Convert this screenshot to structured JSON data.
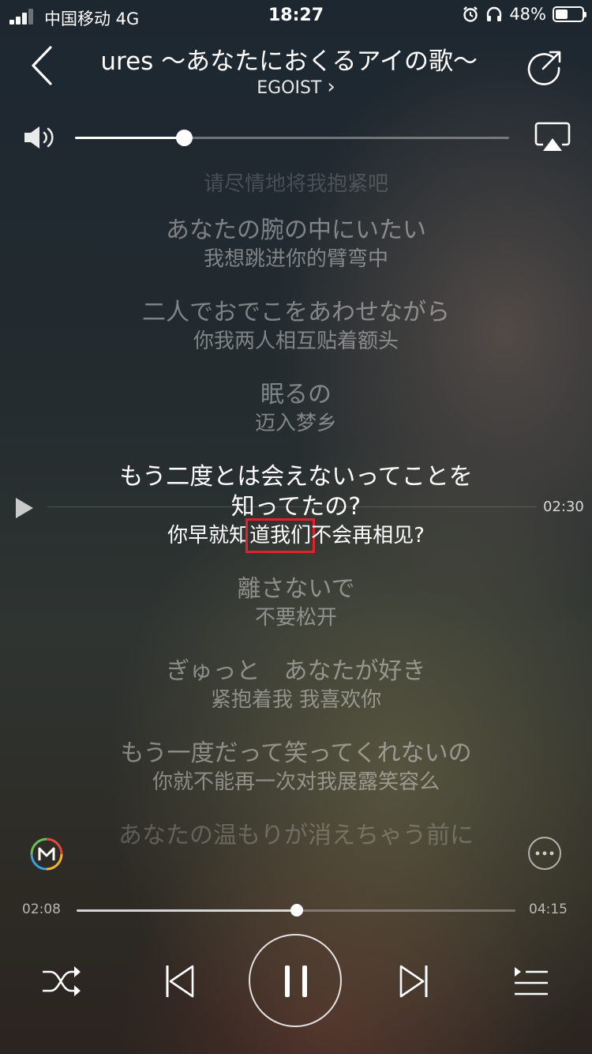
{
  "status_bar": {
    "carrier": "中国移动  4G",
    "time": "18:27",
    "battery_text": "48%",
    "battery_level": 0.48,
    "icons": [
      "signal-icon",
      "alarm-icon",
      "headphones-icon",
      "battery-icon"
    ]
  },
  "header": {
    "title": "Departures 〜あなたにおくるアイの歌〜",
    "artist": "EGOIST",
    "artist_chevron": "›",
    "back_icon": "chevron-left-icon",
    "share_icon": "share-icon"
  },
  "volume": {
    "level": 0.25,
    "icon": "speaker-icon",
    "airplay_icon": "airplay-icon"
  },
  "lyrics": {
    "lines": [
      {
        "jp": "",
        "cn": "请尽情地将我抱紧吧"
      },
      {
        "jp": "あなたの腕の中にいたい",
        "cn": "我想跳进你的臂弯中"
      },
      {
        "jp": "二人でおでこをあわせながら",
        "cn": "你我两人相互贴着额头"
      },
      {
        "jp": "眠るの",
        "cn": "迈入梦乡"
      },
      {
        "jp": "もう二度とは会えないってことを",
        "jp2": "知ってたの?",
        "cn_pre": "你早就知",
        "cn_hl": "道我们",
        "cn_post": "不会再相见?"
      },
      {
        "jp": "離さないで",
        "cn": "不要松开"
      },
      {
        "jp": "ぎゅっと　あなたが好き",
        "cn": "紧抱着我  我喜欢你"
      },
      {
        "jp": "もう一度だって笑ってくれないの",
        "cn": "你就不能再一次对我展露笑容么"
      },
      {
        "jp": "あなたの温もりが消えちゃう前に",
        "cn": ""
      }
    ],
    "seek_time": "02:30",
    "highlight_color": "#e0232b"
  },
  "player": {
    "current_time": "02:08",
    "total_time": "04:15",
    "progress": 0.502,
    "controls": {
      "shuffle_icon": "shuffle-icon",
      "prev_icon": "previous-icon",
      "pause_icon": "pause-icon",
      "next_icon": "next-icon",
      "playlist_icon": "playlist-icon"
    }
  }
}
